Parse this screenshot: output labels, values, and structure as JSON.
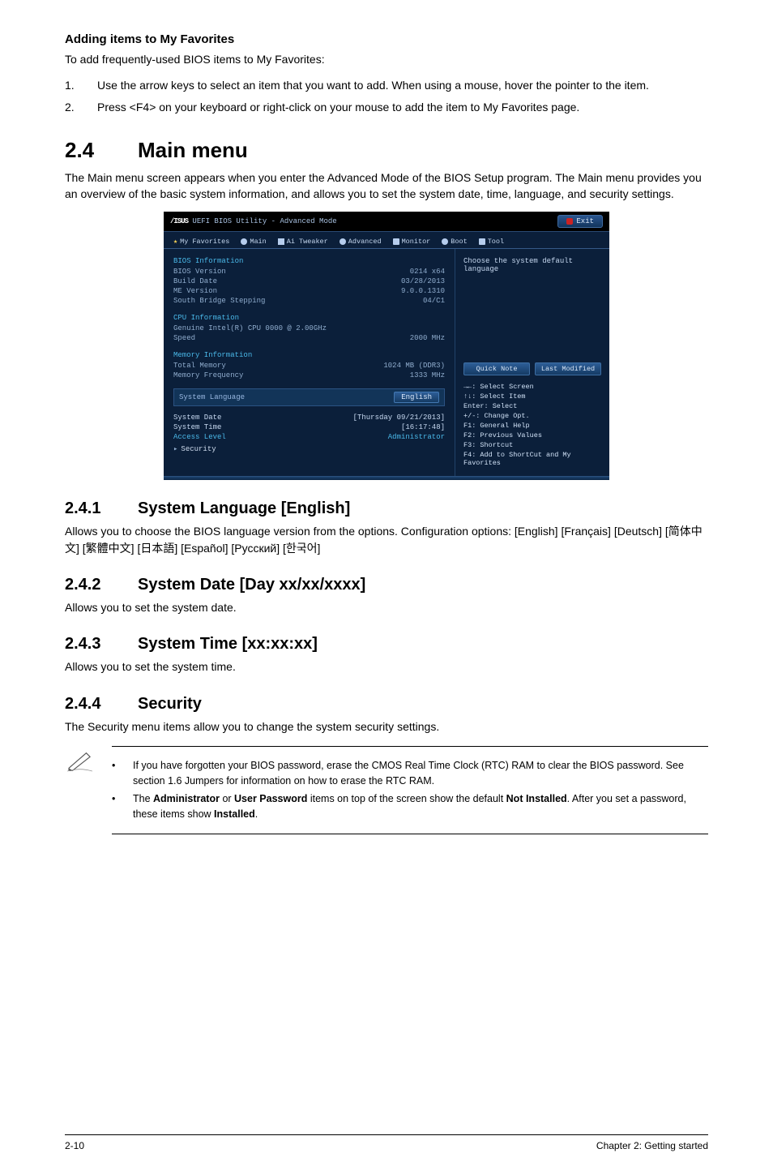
{
  "sec_add": {
    "heading": "Adding items to My Favorites",
    "intro": "To add frequently-used BIOS items to My Favorites:",
    "step1_num": "1.",
    "step1_text": "Use the arrow keys to select an item that you want to add. When using a mouse, hover the pointer to the item.",
    "step2_num": "2.",
    "step2_text": "Press <F4> on your keyboard or right-click on your mouse to add the item to My Favorites page."
  },
  "sec24": {
    "num": "2.4",
    "title": "Main menu",
    "para": "The Main menu screen appears when you enter the Advanced Mode of the BIOS Setup program. The Main menu provides you an overview of the basic system information, and allows you to set the system date, time, language, and security settings."
  },
  "bios": {
    "logo": "/ISUS",
    "title": "UEFI BIOS Utility - Advanced Mode",
    "exit": "Exit",
    "tabs": {
      "fav": "My Favorites",
      "main": "Main",
      "ai": "Ai Tweaker",
      "adv": "Advanced",
      "mon": "Monitor",
      "boot": "Boot",
      "tool": "Tool"
    },
    "bios_info": {
      "title": "BIOS Information",
      "rows": [
        {
          "k": "BIOS Version",
          "v": "0214 x64"
        },
        {
          "k": "Build Date",
          "v": "03/28/2013"
        },
        {
          "k": "ME Version",
          "v": "9.0.0.1310"
        },
        {
          "k": "South Bridge Stepping",
          "v": "04/C1"
        }
      ]
    },
    "cpu_info": {
      "title": "CPU Information",
      "rows": [
        {
          "k": "Genuine Intel(R) CPU 0000 @ 2.00GHz",
          "v": ""
        },
        {
          "k": "Speed",
          "v": "2000 MHz"
        }
      ]
    },
    "mem_info": {
      "title": "Memory Information",
      "rows": [
        {
          "k": "Total Memory",
          "v": "1024 MB (DDR3)"
        },
        {
          "k": "Memory Frequency",
          "v": "1333 MHz"
        }
      ]
    },
    "lang_label": "System Language",
    "lang_value": "English",
    "date_label": "System Date",
    "date_value": "[Thursday 09/21/2013]",
    "time_label": "System Time",
    "time_value": "[16:17:48]",
    "access_label": "Access Level",
    "access_value": "Administrator",
    "security": "Security",
    "right_desc": "Choose the system default language",
    "quick_note": "Quick Note",
    "last_mod": "Last Modified",
    "legend": [
      "→←: Select Screen",
      "↑↓: Select Item",
      "Enter: Select",
      "+/-: Change Opt.",
      "F1: General Help",
      "F2: Previous Values",
      "F3: Shortcut",
      "F4: Add to ShortCut and My Favorites"
    ]
  },
  "sec241": {
    "num": "2.4.1",
    "title": "System Language [English]",
    "para": "Allows you to choose the BIOS language version from the options. Configuration options: [English] [Français] [Deutsch] [简体中文] [繁體中文] [日本語] [Español] [Русский] [한국어]"
  },
  "sec242": {
    "num": "2.4.2",
    "title": "System Date [Day xx/xx/xxxx]",
    "para": "Allows you to set the system date."
  },
  "sec243": {
    "num": "2.4.3",
    "title": "System Time [xx:xx:xx]",
    "para": "Allows you to set the system time."
  },
  "sec244": {
    "num": "2.4.4",
    "title": "Security",
    "para": "The Security menu items allow you to change the system security settings."
  },
  "note": {
    "b1": "If you have forgotten your BIOS password, erase the CMOS Real Time Clock (RTC) RAM to clear the BIOS password. See section 1.6 Jumpers for information on how to erase the RTC RAM.",
    "b2_pre": "The ",
    "b2_b1": "Administrator",
    "b2_mid": " or ",
    "b2_b2": "User Password",
    "b2_post1": " items on top of the screen show the default ",
    "b2_b3": "Not Installed",
    "b2_post2": ". After you set a password, these items show ",
    "b2_b4": "Installed",
    "b2_post3": "."
  },
  "footer": {
    "left": "2-10",
    "right": "Chapter 2: Getting started"
  }
}
